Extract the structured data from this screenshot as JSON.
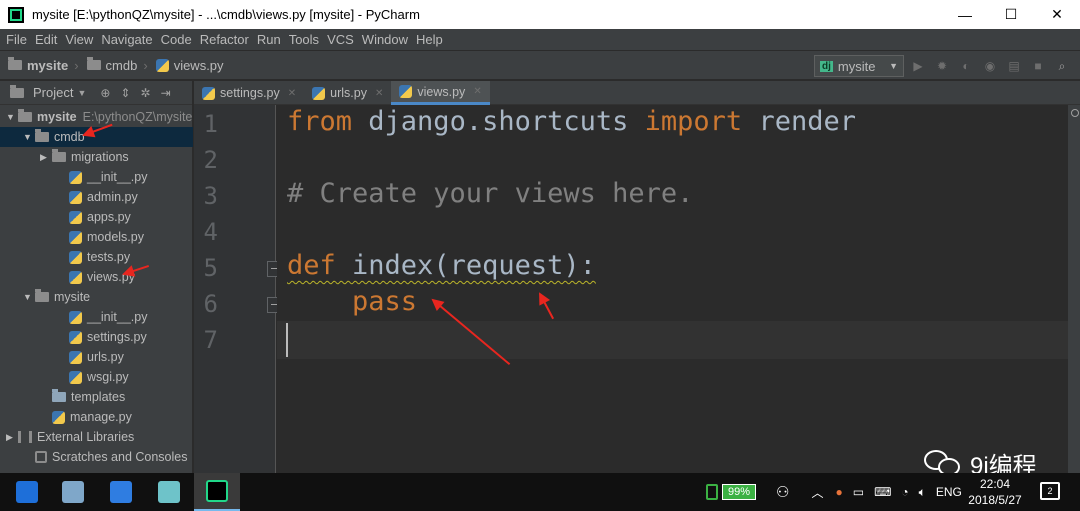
{
  "window": {
    "title": "mysite [E:\\pythonQZ\\mysite] - ...\\cmdb\\views.py [mysite] - PyCharm",
    "controls": [
      "—",
      "☐",
      "✕"
    ]
  },
  "menu": [
    "File",
    "Edit",
    "View",
    "Navigate",
    "Code",
    "Refactor",
    "Run",
    "Tools",
    "VCS",
    "Window",
    "Help"
  ],
  "breadcrumb": [
    "mysite",
    "cmdb",
    "views.py"
  ],
  "run_config": "mysite",
  "project_panel": {
    "label": "Project",
    "tree": [
      {
        "label": "mysite",
        "extra": "E:\\pythonQZ\\mysite",
        "indent": 0,
        "type": "folder",
        "expanded": true
      },
      {
        "label": "cmdb",
        "indent": 1,
        "type": "folder",
        "expanded": true,
        "selected": true
      },
      {
        "label": "migrations",
        "indent": 2,
        "type": "folder",
        "expanded": false
      },
      {
        "label": "__init__.py",
        "indent": 3,
        "type": "py"
      },
      {
        "label": "admin.py",
        "indent": 3,
        "type": "py"
      },
      {
        "label": "apps.py",
        "indent": 3,
        "type": "py"
      },
      {
        "label": "models.py",
        "indent": 3,
        "type": "py"
      },
      {
        "label": "tests.py",
        "indent": 3,
        "type": "py"
      },
      {
        "label": "views.py",
        "indent": 3,
        "type": "py"
      },
      {
        "label": "mysite",
        "indent": 1,
        "type": "folder",
        "expanded": true
      },
      {
        "label": "__init__.py",
        "indent": 3,
        "type": "py"
      },
      {
        "label": "settings.py",
        "indent": 3,
        "type": "py"
      },
      {
        "label": "urls.py",
        "indent": 3,
        "type": "py"
      },
      {
        "label": "wsgi.py",
        "indent": 3,
        "type": "py"
      },
      {
        "label": "templates",
        "indent": 2,
        "type": "folder-blue"
      },
      {
        "label": "manage.py",
        "indent": 2,
        "type": "py"
      },
      {
        "label": "External Libraries",
        "indent": 0,
        "type": "lib",
        "expanded": false
      },
      {
        "label": "Scratches and Consoles",
        "indent": 1,
        "type": "scratch"
      }
    ]
  },
  "tabs": [
    {
      "label": "settings.py",
      "active": false
    },
    {
      "label": "urls.py",
      "active": false
    },
    {
      "label": "views.py",
      "active": true
    }
  ],
  "line_numbers": [
    "1",
    "2",
    "3",
    "4",
    "5",
    "6",
    "7"
  ],
  "code": {
    "line1": {
      "kw1": "from",
      "mid": " django.shortcuts ",
      "kw2": "import",
      "end": " render"
    },
    "line3": "# Create your views here.",
    "line5": {
      "kw": "def",
      "rest": " index(request):"
    },
    "line6": {
      "indent": "    ",
      "kw": "pass"
    }
  },
  "watermark": "9i编程",
  "taskbar": {
    "battery": "99%",
    "lang": "ENG",
    "time": "22:04",
    "date": "2018/5/27",
    "notifications": "2"
  },
  "colors": {
    "keyword": "#cc7832",
    "comment": "#808080",
    "annotation_arrow": "#e8261f",
    "selection": "#0d293e"
  }
}
